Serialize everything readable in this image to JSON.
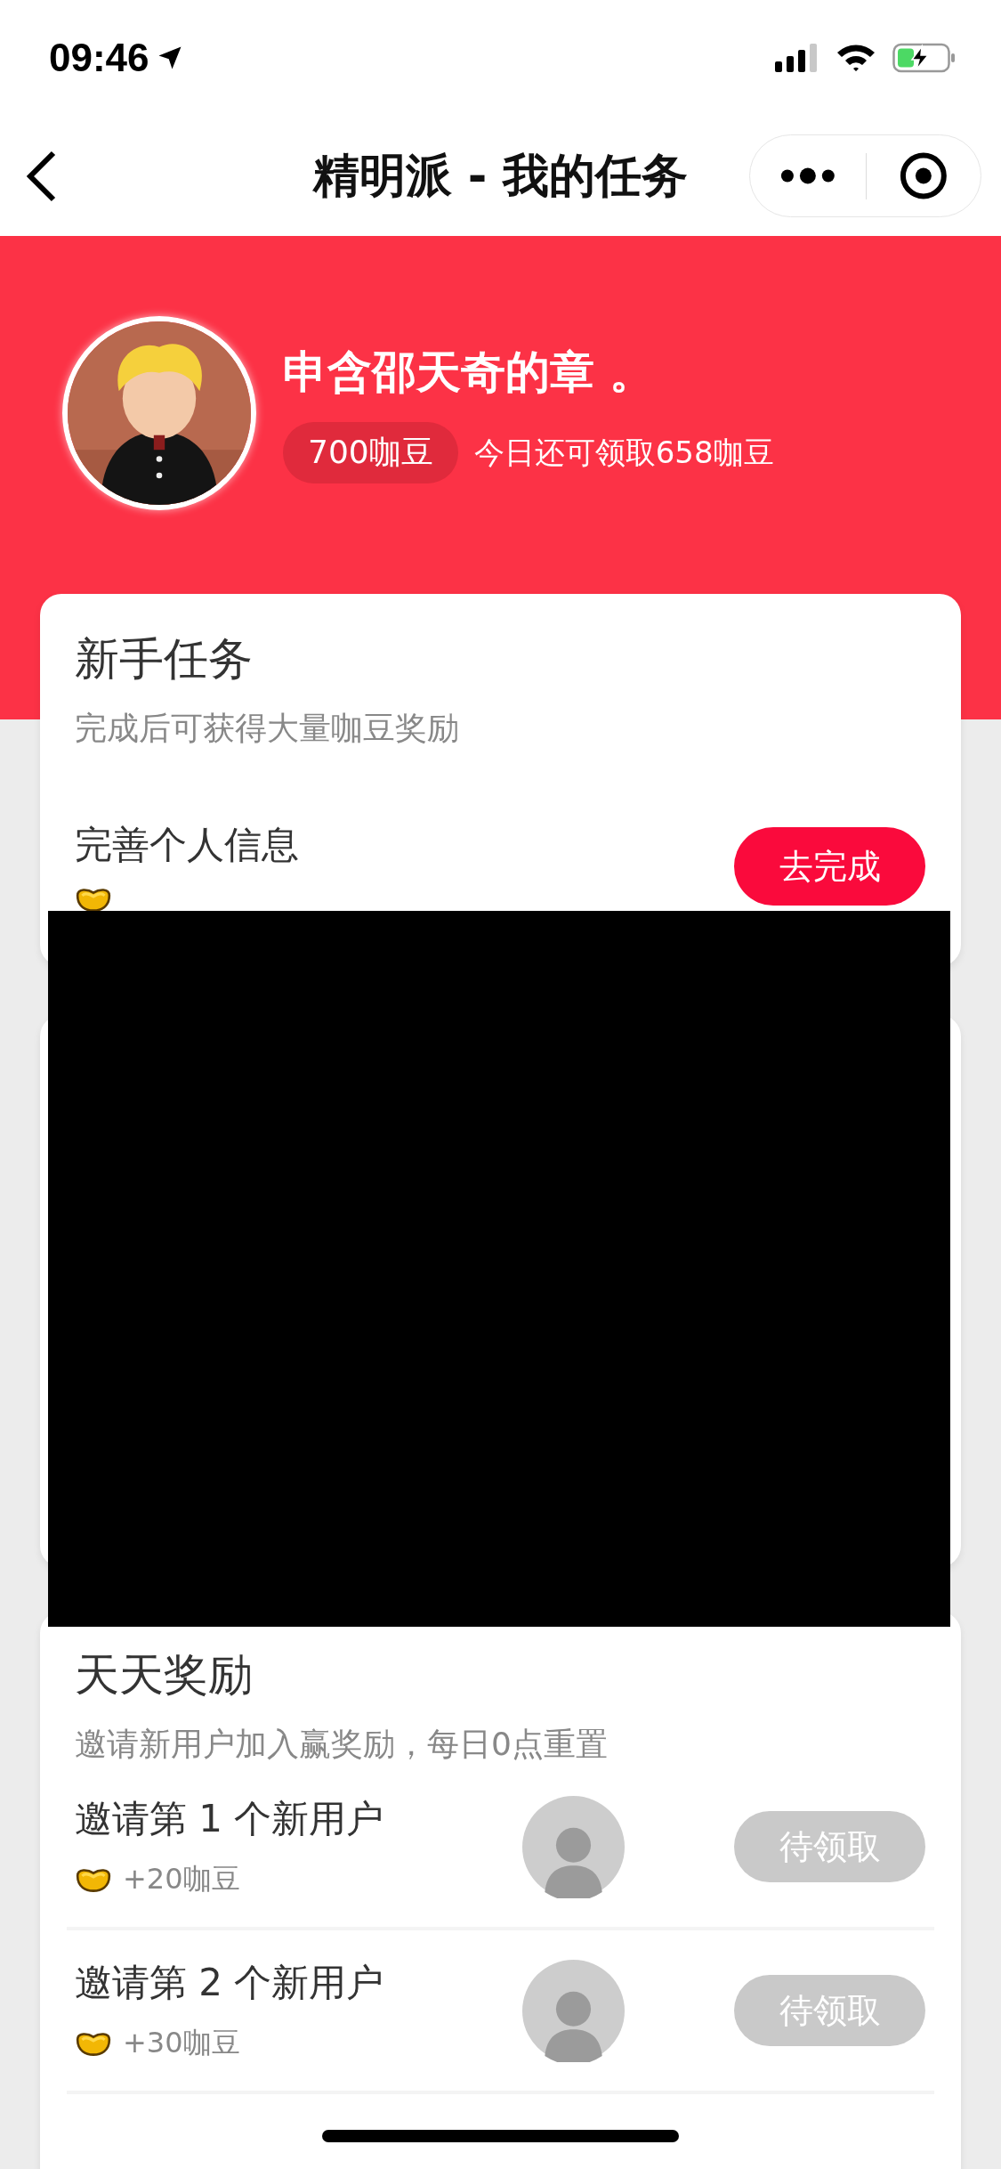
{
  "status_bar": {
    "time": "09:46"
  },
  "nav": {
    "title": "精明派 - 我的任务"
  },
  "profile": {
    "name": "申含邵天奇的章 。",
    "beans": "700咖豆",
    "today_note": "今日还可领取658咖豆"
  },
  "newbie": {
    "title": "新手任务",
    "subtitle": "完成后可获得大量咖豆奖励",
    "tasks": [
      {
        "name": "完善个人信息",
        "button": "去完成",
        "disabled": false
      }
    ]
  },
  "daily": {
    "title": "天天奖励",
    "subtitle": "邀请新用户加入赢奖励，每日0点重置",
    "rows": [
      {
        "name": "邀请第 1 个新用户",
        "reward": "+20咖豆",
        "button": "待领取",
        "disabled": true
      },
      {
        "name": "邀请第 2 个新用户",
        "reward": "+30咖豆",
        "button": "待领取",
        "disabled": true
      }
    ]
  }
}
